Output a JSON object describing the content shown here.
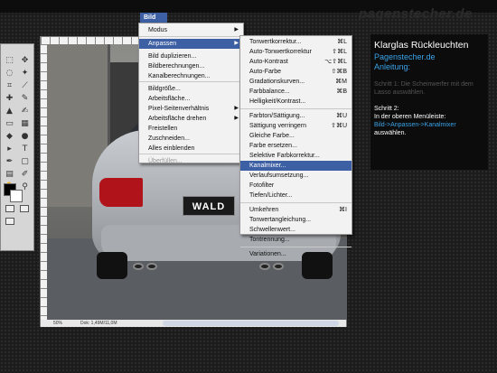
{
  "top_menu": {
    "active_menu": "Bild"
  },
  "brand": {
    "logo_text": "pagenstecher.de"
  },
  "bild_menu": {
    "items": [
      {
        "label": "Modus",
        "submenu": true
      },
      {
        "label": "Anpassen",
        "submenu": true,
        "active": true
      },
      {
        "label": "Bild duplizieren..."
      },
      {
        "label": "Bildberechnungen..."
      },
      {
        "label": "Kanalberechnungen..."
      },
      {
        "label": "Bildgröße..."
      },
      {
        "label": "Arbeitsfläche..."
      },
      {
        "label": "Pixel-Seitenverhältnis",
        "submenu": true
      },
      {
        "label": "Arbeitsfläche drehen",
        "submenu": true
      },
      {
        "label": "Freistellen"
      },
      {
        "label": "Zuschneiden..."
      },
      {
        "label": "Alles einblenden"
      },
      {
        "label": "Überfüllen...",
        "disabled": true
      }
    ]
  },
  "anpassen_menu": {
    "items": [
      {
        "label": "Tonwertkorrektur...",
        "shortcut": "⌘L"
      },
      {
        "label": "Auto-Tonwertkorrektur",
        "shortcut": "⇧⌘L"
      },
      {
        "label": "Auto-Kontrast",
        "shortcut": "⌥⇧⌘L"
      },
      {
        "label": "Auto-Farbe",
        "shortcut": "⇧⌘B"
      },
      {
        "label": "Gradationskurven...",
        "shortcut": "⌘M"
      },
      {
        "label": "Farbbalance...",
        "shortcut": "⌘B"
      },
      {
        "label": "Helligkeit/Kontrast..."
      },
      {
        "label": "Farbton/Sättigung...",
        "shortcut": "⌘U"
      },
      {
        "label": "Sättigung verringern",
        "shortcut": "⇧⌘U"
      },
      {
        "label": "Gleiche Farbe..."
      },
      {
        "label": "Farbe ersetzen..."
      },
      {
        "label": "Selektive Farbkorrektur..."
      },
      {
        "label": "Kanalmixer...",
        "active": true
      },
      {
        "label": "Verlaufsumsetzung..."
      },
      {
        "label": "Fotofilter"
      },
      {
        "label": "Tiefen/Lichter..."
      },
      {
        "label": "Umkehren",
        "shortcut": "⌘I"
      },
      {
        "label": "Tonwertangleichung..."
      },
      {
        "label": "Schwellenwert..."
      },
      {
        "label": "Tontrennung..."
      },
      {
        "label": "Variationen..."
      }
    ]
  },
  "document": {
    "plate_text": "WALD",
    "zoom": "50%",
    "doc_size": "Dok: 1,49M/11,0M"
  },
  "tutorial": {
    "title": "Klarglas Rückleuchten",
    "site": "Pagenstecher.de",
    "guide_label": "Anleitung:",
    "step1": "Schritt 1: Die Scheinwerfer mit dem Lasso auswählen.",
    "step2_label": "Schritt 2:",
    "step2_text": "In der oberen Menüleiste:",
    "step2_path": "Bild->Anpassen->Kanalmixer",
    "step2_end": "auswählen."
  },
  "colors": {
    "menu_highlight": "#3d5fa3",
    "link_blue": "#3aa3e8",
    "taillight_red": "#b0141a"
  }
}
